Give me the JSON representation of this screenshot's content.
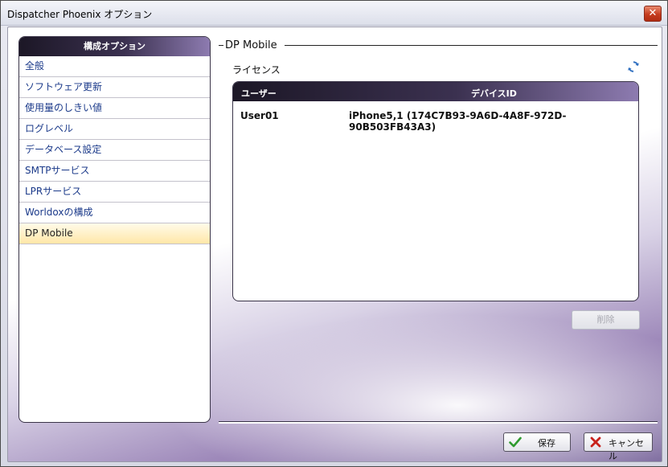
{
  "window": {
    "title": "Dispatcher Phoenix オプション",
    "close_glyph": "✕"
  },
  "sidebar": {
    "header": "構成オプション",
    "items": [
      {
        "label": "全般"
      },
      {
        "label": "ソフトウェア更新"
      },
      {
        "label": "使用量のしきい値"
      },
      {
        "label": "ログレベル"
      },
      {
        "label": "データベース設定"
      },
      {
        "label": "SMTPサービス"
      },
      {
        "label": "LPRサービス"
      },
      {
        "label": "Worldoxの構成"
      },
      {
        "label": "DP Mobile",
        "selected": true
      }
    ]
  },
  "main": {
    "section_title": "DP Mobile",
    "license_label": "ライセンス",
    "refresh_icon": "refresh-icon",
    "table": {
      "headers": {
        "user": "ユーザー",
        "device_id": "デバイスID"
      },
      "rows": [
        {
          "user": "User01",
          "device_id": "iPhone5,1 (174C7B93-9A6D-4A8F-972D-90B503FB43A3)"
        }
      ]
    },
    "delete_label": "削除"
  },
  "footer": {
    "save_label": "保存",
    "cancel_label": "キャンセル"
  },
  "colors": {
    "accent_dark": "#1c1726",
    "accent_light": "#8d7bb0",
    "selected_bg": "#ffe7a8",
    "link_text": "#1b3a8a"
  }
}
